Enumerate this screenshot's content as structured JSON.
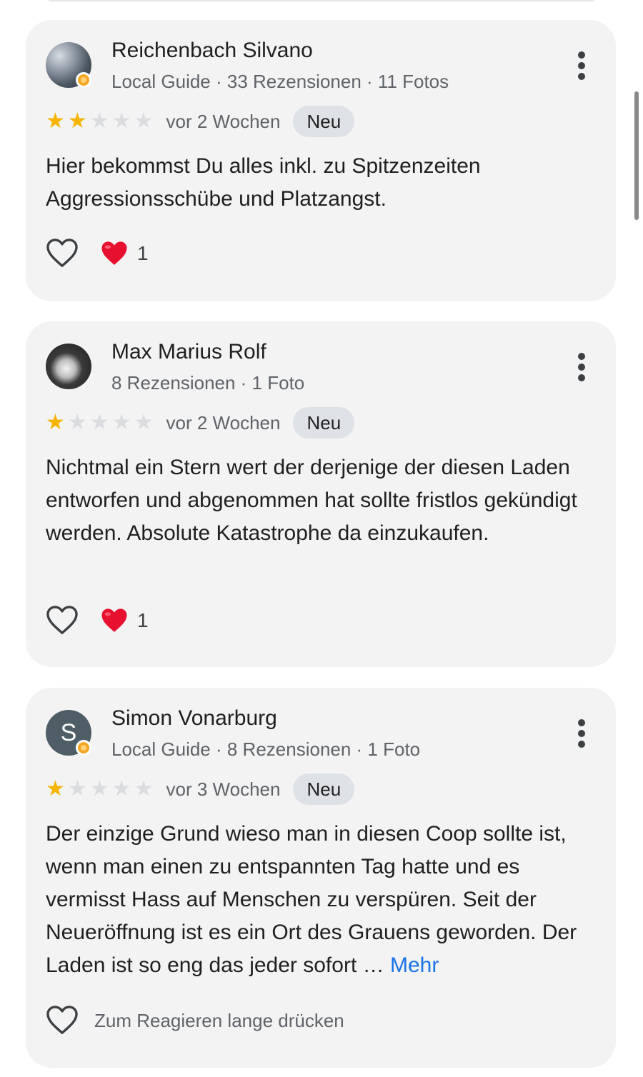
{
  "reviews": [
    {
      "name": "Reichenbach Silvano",
      "meta": "Local Guide · 33 Rezensionen · 11 Fotos",
      "rating": 2,
      "time": "vor 2 Wochen",
      "badge": "Neu",
      "text": "Hier bekommst Du alles inkl. zu Spitzenzeiten Aggressionsschübe und Platzangst.",
      "reaction_count": "1",
      "avatar_icon": "avatar-photo",
      "local_guide": true
    },
    {
      "name": "Max Marius Rolf",
      "meta": "8 Rezensionen · 1 Foto",
      "rating": 1,
      "time": "vor 2 Wochen",
      "badge": "Neu",
      "text": "Nichtmal ein Stern wert der derjenige der diesen Laden entworfen und abgenommen hat sollte fristlos gekündigt werden. Absolute Katastrophe da einzukaufen.",
      "reaction_count": "1",
      "avatar_icon": "avatar-photo",
      "local_guide": false
    },
    {
      "name": "Simon Vonarburg",
      "meta": "Local Guide · 8 Rezensionen · 1 Foto",
      "avatar_letter": "S",
      "rating": 1,
      "time": "vor 3 Wochen",
      "badge": "Neu",
      "text": "Der einzige Grund wieso man in diesen Coop sollte ist, wenn man einen zu entspannten Tag hatte und es vermisst Hass auf Menschen zu verspüren. Seit der Neueröffnung ist es ein Ort des Grauens geworden. Der Laden ist so eng das jeder sofort … ",
      "more_link": "Mehr",
      "reaction_hint": "Zum Reagieren lange drücken",
      "local_guide": true
    }
  ],
  "colors": {
    "card_background": "#f3f3f3",
    "star_filled": "#f4b400",
    "star_empty": "#dadce0",
    "link": "#1a73e8",
    "heart": "#e8102f"
  },
  "icons": {
    "more": "more-vert-icon",
    "like": "heart-outline-icon",
    "reaction": "red-heart-icon",
    "star": "star-icon",
    "badge": "local-guide-badge-icon"
  }
}
